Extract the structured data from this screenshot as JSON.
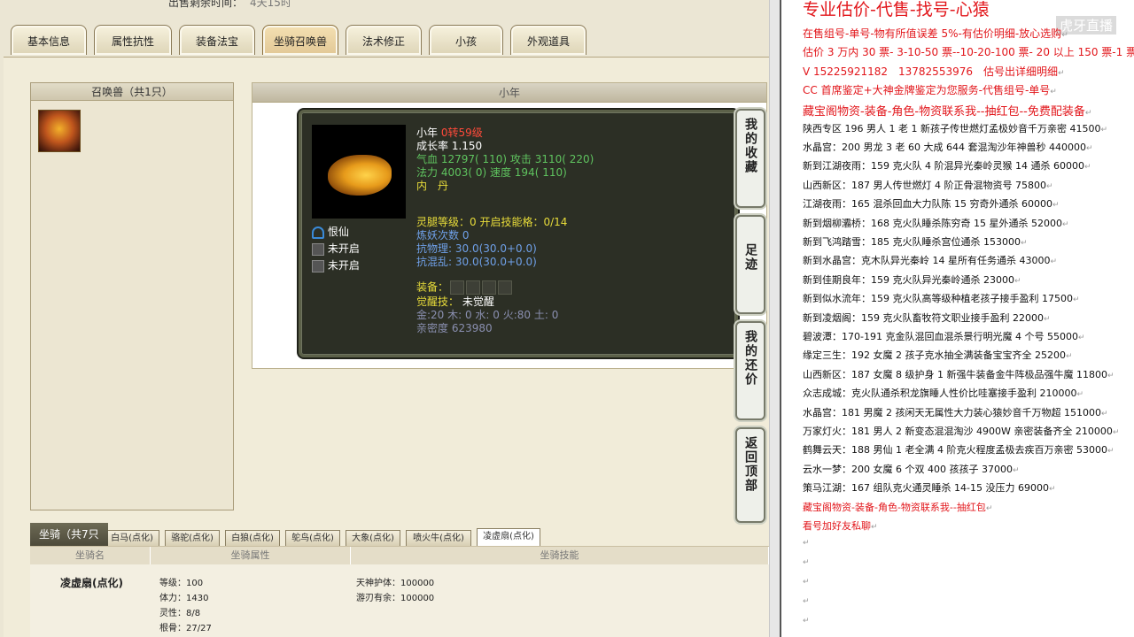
{
  "top_note": {
    "label": "出售剩余时间：",
    "value": "4天15时"
  },
  "tabs": [
    "基本信息",
    "属性抗性",
    "装备法宝",
    "坐骑召唤兽",
    "法术修正",
    "小孩",
    "外观道具"
  ],
  "active_tab": "坐骑召唤兽",
  "summon_panel": {
    "header": "召唤兽（共1只）"
  },
  "detail_panel": {
    "header": "小年"
  },
  "pet": {
    "name": "小年",
    "level": "0转59级",
    "growth": "成长率 1.150",
    "hp": "气血 12797( 110) 攻击 3110( 220)",
    "mp": "法力 4003( 0) 速度 194( 110)",
    "danyao": "内　丹",
    "skills": [
      "恨仙",
      "未开启",
      "未开启"
    ],
    "ling": "灵腿等级：0 开启技能格：0/14",
    "lianyao": "炼妖次数 0",
    "resist_phys": "抗物理: 30.0(30.0+0.0)",
    "resist_chaos": "抗混乱: 30.0(30.0+0.0)",
    "equip_label": "装备：",
    "awaken_label": "觉醒技：",
    "awaken_value": "未觉醒",
    "elements": "金:20 木: 0 水: 0 火:80 土: 0",
    "intimacy": "亲密度 623980"
  },
  "side_buttons": [
    "我的收藏",
    "足迹",
    "我的还价",
    "返回顶部"
  ],
  "mount": {
    "header": "坐骑（共7只",
    "tabs": [
      "白马(点化)",
      "骆驼(点化)",
      "白狼(点化)",
      "鸵鸟(点化)",
      "大象(点化)",
      "喷火牛(点化)",
      "凌虚扇(点化)"
    ],
    "columns": [
      "坐骑名",
      "坐骑属性",
      "坐骑技能"
    ],
    "name": "凌虚扇(点化)",
    "attrs": [
      "等级：100",
      "体力：1430",
      "灵性：8/8",
      "根骨：27/27"
    ],
    "skills": [
      "天神护体：100000",
      "游刃有余：100000"
    ]
  },
  "right_doc": {
    "title": "专业估价-代售-找号-心猿",
    "watermark": "虎牙直播",
    "lines": [
      {
        "text": "在售组号-单号-物有所值误差 5%-有估价明细-放心选购",
        "red": true
      },
      {
        "text": "估价 3 万内 30 票- 3-10-50 票--10-20-100 票- 20 以上 150 票-1 票 1 元",
        "red": true
      },
      {
        "text": "V 15225921182　13782553976　估号出详细明细",
        "red": true
      },
      {
        "text": "CC 首席鉴定+大神金牌鉴定为您服务-代售组号-单号",
        "red": true
      },
      {
        "text": "藏宝阁物资-装备-角色-物资联系我--抽红包--免费配装备",
        "red": true
      },
      {
        "text": "陕西专区 196 男人 1 老 1 新孩子传世燃灯孟极妙音千万亲密 41500",
        "red": false
      },
      {
        "text": "水晶宫：200 男龙 3 老 60 大成 644 套混淘沙年神兽秒 440000",
        "red": false
      },
      {
        "text": "新到江湖夜雨：159 克火队 4 阶混异光秦岭灵猴 14 通杀 60000",
        "red": false
      },
      {
        "text": "山西新区：187 男人传世燃灯 4 阶正骨混物资号 75800",
        "red": false
      },
      {
        "text": "江湖夜雨：165 混杀回血大力队陈 15 穷奇外通杀 60000",
        "red": false
      },
      {
        "text": "新到烟柳灞桥：168 克火队睡杀陈穷奇 15 星外通杀 52000",
        "red": false
      },
      {
        "text": "新到飞鸿踏雪：185 克火队睡杀宫位通杀 153000",
        "red": false
      },
      {
        "text": "新到水晶宫：克木队异光秦岭 14 星所有任务通杀 43000",
        "red": false
      },
      {
        "text": "新到佳期良年：159 克火队异光秦岭通杀 23000",
        "red": false
      },
      {
        "text": "新到似水流年：159 克火队高等级种植老孩子接手盈利 17500",
        "red": false
      },
      {
        "text": "新到凌烟阁：159 克火队畜牧符文职业接手盈利 22000",
        "red": false
      },
      {
        "text": "碧波潭：170-191 克金队混回血混杀景行明光魔 4 个号 55000",
        "red": false
      },
      {
        "text": "缘定三生：192 女魔 2 孩子克水抽全满装备宝宝齐全 25200",
        "red": false
      },
      {
        "text": "山西新区：187 女魔 8 级护身 1 新强牛装备金牛阵极品强牛魔 11800",
        "red": false
      },
      {
        "text": "众志成城：克火队通杀积龙旗睡人性价比哇塞接手盈利 210000",
        "red": false
      },
      {
        "text": "水晶宫：181 男魔 2 孩闲天无属性大力装心猿妙音千万物超 151000",
        "red": false
      },
      {
        "text": "万家灯火：181 男人 2 新变态混混淘沙 4900W 亲密装备齐全 210000",
        "red": false
      },
      {
        "text": "鹤舞云天：188 男仙 1 老全满 4 阶克火程度孟极去疾百万亲密 53000",
        "red": false
      },
      {
        "text": "云水一梦：200 女魔 6 个双 400 孩孩子 37000",
        "red": false
      },
      {
        "text": "策马江湖：167 组队克火通灵睡杀 14-15 没压力 69000",
        "red": false
      },
      {
        "text": "藏宝阁物资-装备-角色-物资联系我--抽红包",
        "red": true
      },
      {
        "text": "看号加好友私聊",
        "red": true
      }
    ],
    "return_mark": "↵"
  },
  "colors": {
    "accent_red": "#e2161b",
    "card_bg": "#2c2f25",
    "yellow": "#e8dc3a",
    "green": "#5fc35f",
    "blue": "#6fa0e8"
  }
}
